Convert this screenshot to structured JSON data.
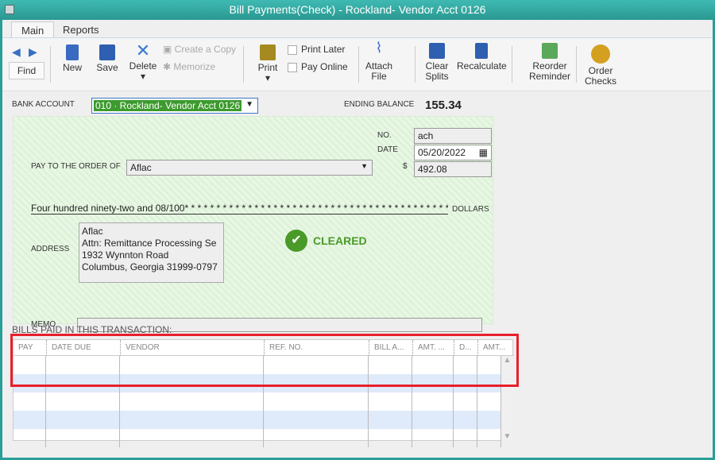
{
  "window": {
    "title": "Bill Payments(Check) - Rockland- Vendor Acct 0126"
  },
  "tabs": [
    {
      "label": "Main"
    },
    {
      "label": "Reports"
    }
  ],
  "toolbar": {
    "find": "Find",
    "new": "New",
    "save": "Save",
    "delete": "Delete",
    "create_copy": "Create a Copy",
    "memorize": "Memorize",
    "print": "Print",
    "print_later": "Print Later",
    "pay_online": "Pay Online",
    "attach_file": "Attach File",
    "clear_splits": "Clear Splits",
    "recalculate": "Recalculate",
    "reorder_reminder": "Reorder Reminder",
    "order_checks": "Order Checks"
  },
  "bank": {
    "label": "BANK ACCOUNT",
    "value": "010 · Rockland- Vendor Acct 0126",
    "ending_label": "ENDING BALANCE",
    "ending_value": "155.34"
  },
  "check": {
    "no_label": "NO.",
    "no": "ach",
    "date_label": "DATE",
    "date": "05/20/2022",
    "amount_label": "$",
    "amount": "492.08",
    "pay_label": "PAY TO THE ORDER OF",
    "payee": "Aflac",
    "words": "Four hundred ninety-two and 08/100* * * * * * * * * * * * * * * * * * * * * * * * * * * * * * * * * * * * * * * * * * * * * *",
    "dollars": "DOLLARS",
    "address_label": "ADDRESS",
    "address": [
      "Aflac",
      "Attn:  Remittance Processing Se",
      "1932 Wynnton Road",
      "Columbus, Georgia  31999-0797"
    ],
    "status": "CLEARED",
    "memo_label": "MEMO",
    "memo": ""
  },
  "bills": {
    "title": "BILLS PAID IN THIS TRANSACTION:",
    "columns": [
      "PAY",
      "DATE DUE",
      "VENDOR",
      "REF. NO.",
      "BILL A...",
      "AMT. ...",
      "D...",
      "AMT..."
    ]
  },
  "colors": {
    "title_bar": "#2a9e98",
    "highlight": "#e8202a",
    "cleared": "#4a9a2a"
  }
}
